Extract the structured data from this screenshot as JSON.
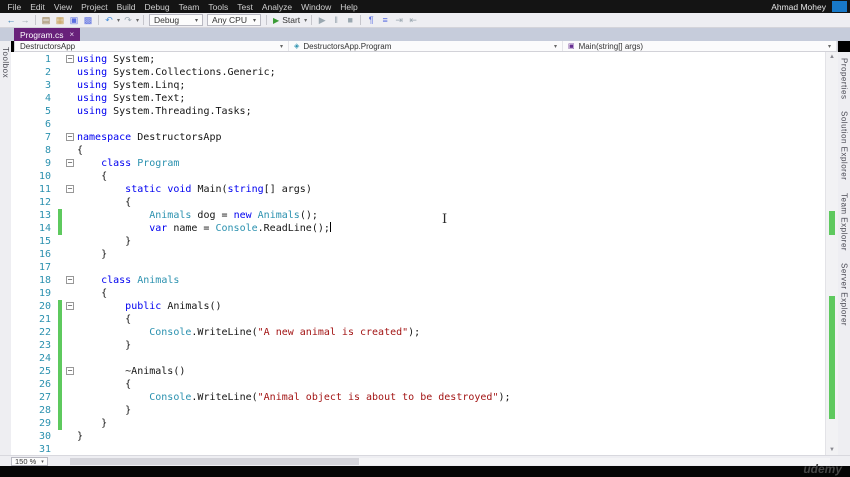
{
  "titlebar": {
    "user": "Ahmad Mohey",
    "menu": [
      "File",
      "Edit",
      "View",
      "Project",
      "Build",
      "Debug",
      "Team",
      "Tools",
      "Test",
      "Analyze",
      "Window",
      "Help"
    ]
  },
  "toolbar": {
    "items": [
      {
        "t": "icon",
        "name": "nav-back-icon",
        "g": "←",
        "c": "#2a7ab0"
      },
      {
        "t": "icon",
        "name": "nav-forward-icon",
        "g": "→",
        "c": "#9aa7b0"
      },
      {
        "t": "sep"
      },
      {
        "t": "icon",
        "name": "new-file-icon",
        "g": "▤",
        "c": "#8a6d3b"
      },
      {
        "t": "icon",
        "name": "open-file-icon",
        "g": "▦",
        "c": "#c49b4a"
      },
      {
        "t": "icon",
        "name": "save-icon",
        "g": "▣",
        "c": "#5b6ee1"
      },
      {
        "t": "icon",
        "name": "save-all-icon",
        "g": "▩",
        "c": "#5b6ee1"
      },
      {
        "t": "sep"
      },
      {
        "t": "icon",
        "name": "undo-icon",
        "g": "↶",
        "c": "#4a90d9"
      },
      {
        "t": "chev"
      },
      {
        "t": "icon",
        "name": "redo-icon",
        "g": "↷",
        "c": "#9aa7b0"
      },
      {
        "t": "chev"
      },
      {
        "t": "sep"
      },
      {
        "t": "dd",
        "name": "configuration-dropdown",
        "label": "Debug"
      },
      {
        "t": "dd",
        "name": "platform-dropdown",
        "label": "Any CPU"
      },
      {
        "t": "sep"
      },
      {
        "t": "start",
        "name": "start-button",
        "label": "Start"
      },
      {
        "t": "chev"
      },
      {
        "t": "sep"
      },
      {
        "t": "icon",
        "name": "run-icon",
        "g": "▶",
        "c": "#9aa7b0"
      },
      {
        "t": "icon",
        "name": "pause-icon",
        "g": "‖",
        "c": "#9aa7b0"
      },
      {
        "t": "icon",
        "name": "stop-icon",
        "g": "■",
        "c": "#9aa7b0"
      },
      {
        "t": "sep"
      },
      {
        "t": "icon",
        "name": "show-whitespace-icon",
        "g": "¶",
        "c": "#5b6ee1"
      },
      {
        "t": "icon",
        "name": "comment-icon",
        "g": "≡",
        "c": "#5b6ee1"
      },
      {
        "t": "icon",
        "name": "indent-icon",
        "g": "⇥",
        "c": "#9aa7b0"
      },
      {
        "t": "icon",
        "name": "outdent-icon",
        "g": "⇤",
        "c": "#9aa7b0"
      }
    ]
  },
  "tabs": {
    "active": "Program.cs"
  },
  "breadcrumb": {
    "items": [
      {
        "label": "DestructorsApp"
      },
      {
        "label": "DestructorsApp.Program",
        "icon_name": "class-icon",
        "icon_glyph": "◈",
        "icon_color": "#2b91af"
      },
      {
        "label": "Main(string[] args)",
        "icon_name": "method-icon",
        "icon_glyph": "▣",
        "icon_color": "#652d90"
      }
    ]
  },
  "side_panels": {
    "left": [
      "Toolbox"
    ],
    "right": [
      "Properties",
      "Solution Explorer",
      "Team Explorer",
      "Server Explorer"
    ]
  },
  "editor": {
    "zoom": "150 %",
    "caret_line": 14,
    "fold_lines": [
      1,
      7,
      9,
      11,
      18,
      20,
      25
    ],
    "changed_lines": [
      13,
      14,
      20,
      21,
      22,
      23,
      24,
      25,
      26,
      27,
      28,
      29
    ],
    "lines": [
      {
        "n": 1,
        "segs": [
          [
            "k",
            "using"
          ],
          [
            "p",
            " System;"
          ]
        ]
      },
      {
        "n": 2,
        "segs": [
          [
            "k",
            "using"
          ],
          [
            "p",
            " System.Collections.Generic;"
          ]
        ]
      },
      {
        "n": 3,
        "segs": [
          [
            "k",
            "using"
          ],
          [
            "p",
            " System.Linq;"
          ]
        ]
      },
      {
        "n": 4,
        "segs": [
          [
            "k",
            "using"
          ],
          [
            "p",
            " System.Text;"
          ]
        ]
      },
      {
        "n": 5,
        "segs": [
          [
            "k",
            "using"
          ],
          [
            "p",
            " System.Threading.Tasks;"
          ]
        ]
      },
      {
        "n": 6,
        "segs": []
      },
      {
        "n": 7,
        "segs": [
          [
            "k",
            "namespace"
          ],
          [
            "p",
            " DestructorsApp"
          ]
        ]
      },
      {
        "n": 8,
        "segs": [
          [
            "p",
            "{"
          ]
        ]
      },
      {
        "n": 9,
        "segs": [
          [
            "p",
            "    "
          ],
          [
            "k",
            "class"
          ],
          [
            "p",
            " "
          ],
          [
            "t",
            "Program"
          ]
        ]
      },
      {
        "n": 10,
        "segs": [
          [
            "p",
            "    {"
          ]
        ]
      },
      {
        "n": 11,
        "segs": [
          [
            "p",
            "        "
          ],
          [
            "k",
            "static"
          ],
          [
            "p",
            " "
          ],
          [
            "k",
            "void"
          ],
          [
            "p",
            " Main("
          ],
          [
            "k",
            "string"
          ],
          [
            "p",
            "[] args)"
          ]
        ]
      },
      {
        "n": 12,
        "segs": [
          [
            "p",
            "        {"
          ]
        ]
      },
      {
        "n": 13,
        "segs": [
          [
            "p",
            "            "
          ],
          [
            "t",
            "Animals"
          ],
          [
            "p",
            " dog = "
          ],
          [
            "k",
            "new"
          ],
          [
            "p",
            " "
          ],
          [
            "t",
            "Animals"
          ],
          [
            "p",
            "();"
          ]
        ]
      },
      {
        "n": 14,
        "segs": [
          [
            "p",
            "            "
          ],
          [
            "k",
            "var"
          ],
          [
            "p",
            " name = "
          ],
          [
            "t",
            "Console"
          ],
          [
            "p",
            ".ReadLine();"
          ]
        ]
      },
      {
        "n": 15,
        "segs": [
          [
            "p",
            "        }"
          ]
        ]
      },
      {
        "n": 16,
        "segs": [
          [
            "p",
            "    }"
          ]
        ]
      },
      {
        "n": 17,
        "segs": []
      },
      {
        "n": 18,
        "segs": [
          [
            "p",
            "    "
          ],
          [
            "k",
            "class"
          ],
          [
            "p",
            " "
          ],
          [
            "t",
            "Animals"
          ]
        ]
      },
      {
        "n": 19,
        "segs": [
          [
            "p",
            "    {"
          ]
        ]
      },
      {
        "n": 20,
        "segs": [
          [
            "p",
            "        "
          ],
          [
            "k",
            "public"
          ],
          [
            "p",
            " Animals()"
          ]
        ]
      },
      {
        "n": 21,
        "segs": [
          [
            "p",
            "        {"
          ]
        ]
      },
      {
        "n": 22,
        "segs": [
          [
            "p",
            "            "
          ],
          [
            "t",
            "Console"
          ],
          [
            "p",
            ".WriteLine("
          ],
          [
            "s",
            "\"A new animal is created\""
          ],
          [
            "p",
            ");"
          ]
        ]
      },
      {
        "n": 23,
        "segs": [
          [
            "p",
            "        }"
          ]
        ]
      },
      {
        "n": 24,
        "segs": []
      },
      {
        "n": 25,
        "segs": [
          [
            "p",
            "        ~Animals()"
          ]
        ]
      },
      {
        "n": 26,
        "segs": [
          [
            "p",
            "        {"
          ]
        ]
      },
      {
        "n": 27,
        "segs": [
          [
            "p",
            "            "
          ],
          [
            "t",
            "Console"
          ],
          [
            "p",
            ".WriteLine("
          ],
          [
            "s",
            "\"Animal object is about to be destroyed\""
          ],
          [
            "p",
            ");"
          ]
        ]
      },
      {
        "n": 28,
        "segs": [
          [
            "p",
            "        }"
          ]
        ]
      },
      {
        "n": 29,
        "segs": [
          [
            "p",
            "    }"
          ]
        ]
      },
      {
        "n": 30,
        "segs": [
          [
            "p",
            "}"
          ]
        ]
      },
      {
        "n": 31,
        "segs": []
      }
    ]
  },
  "colors": {
    "keyword": "#0000f0",
    "type": "#2b91af",
    "string": "#a31515",
    "active_tab": "#68217a",
    "change_bar": "#5ec95e",
    "line_number": "#2b91af"
  },
  "watermark": "udemy"
}
